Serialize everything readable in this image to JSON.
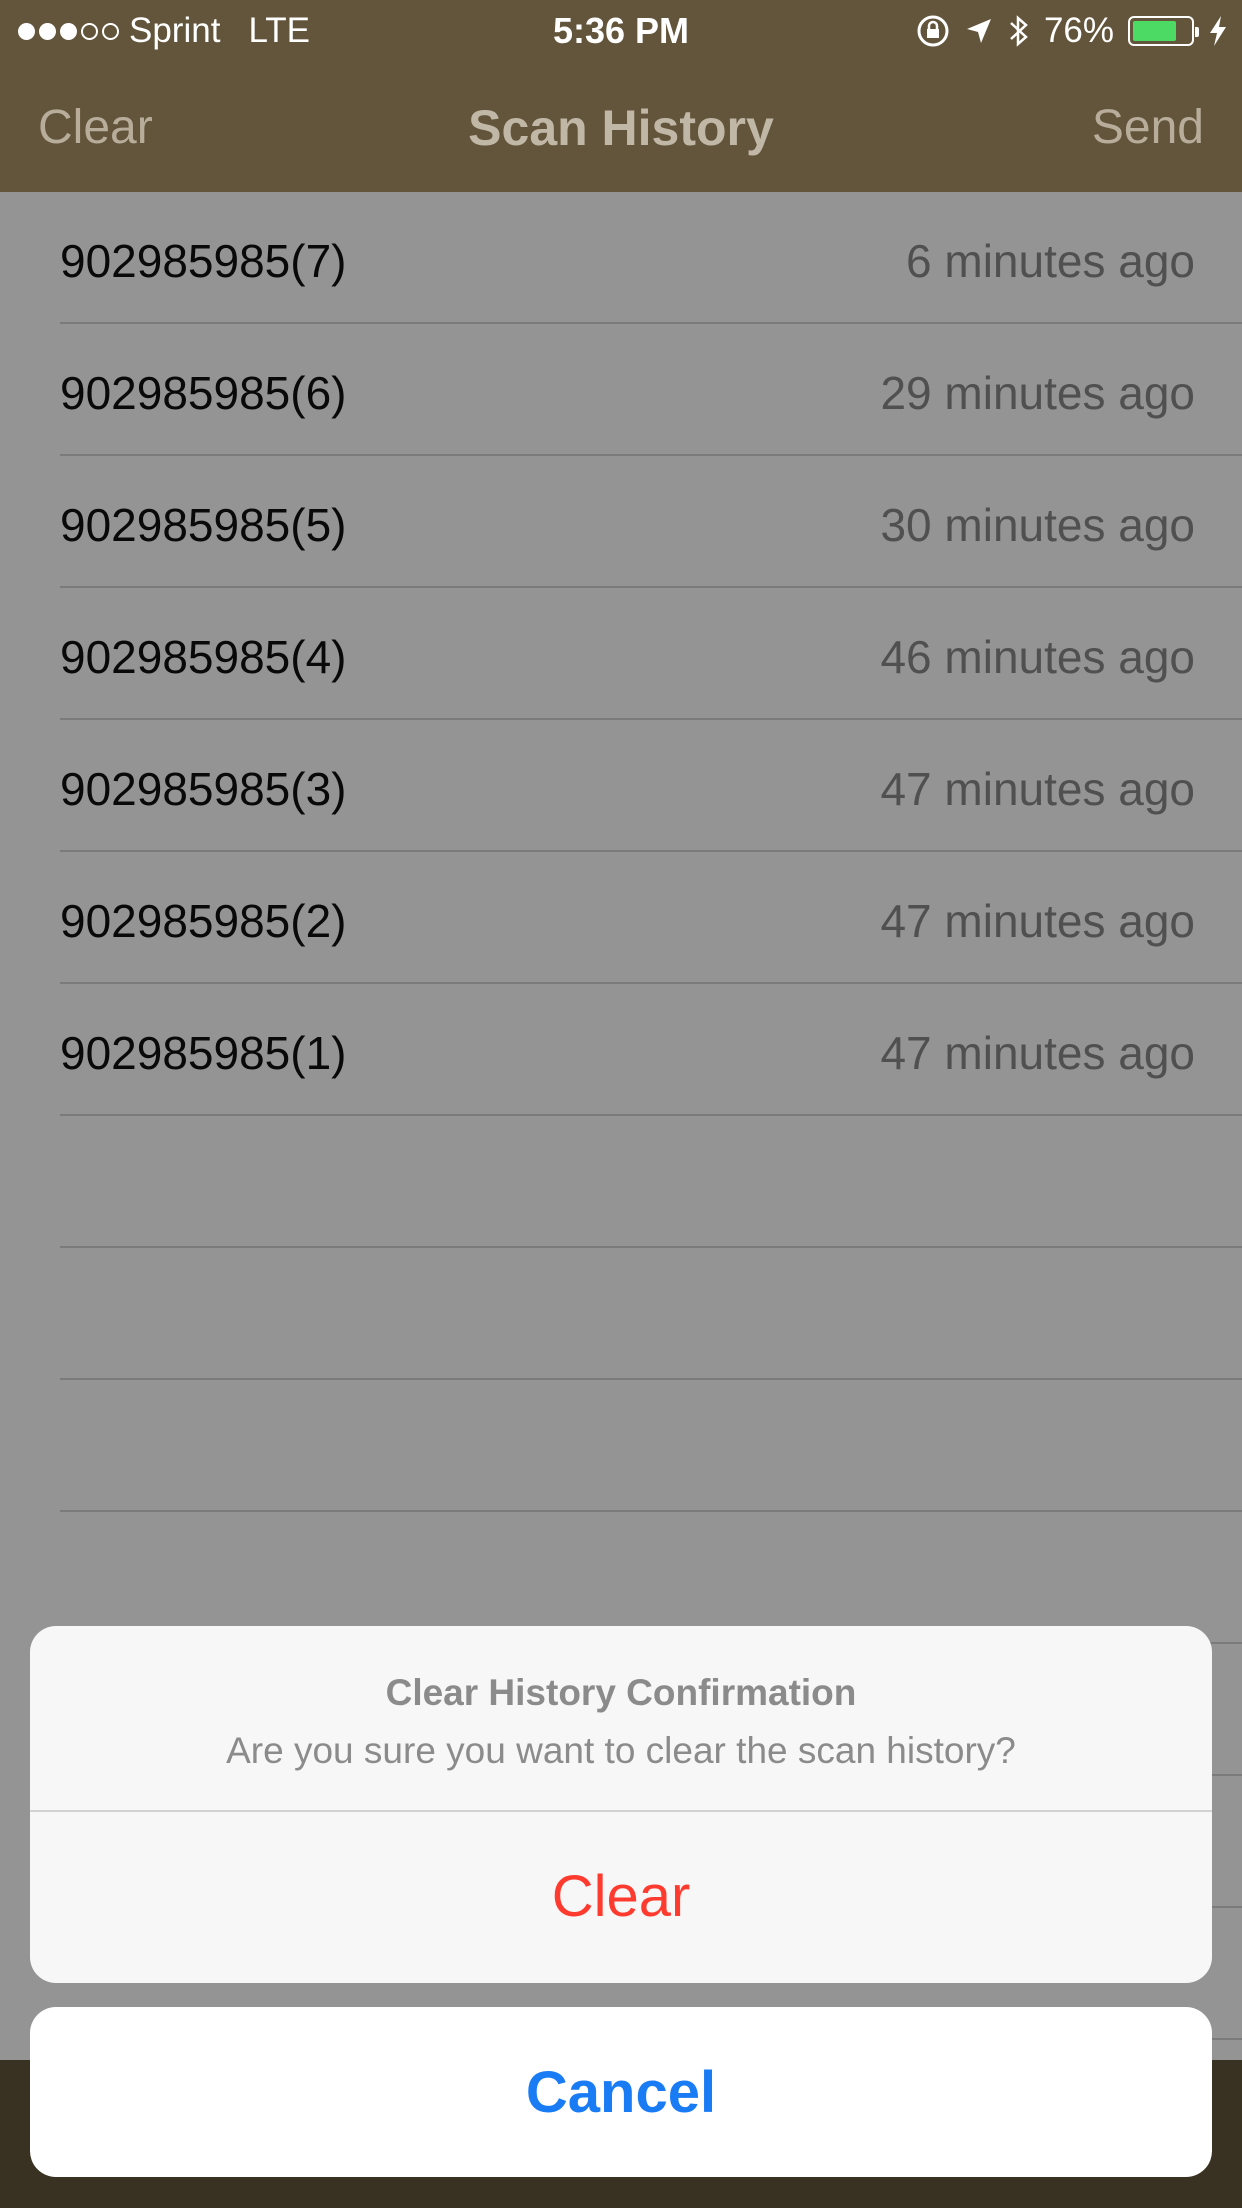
{
  "status_bar": {
    "carrier": "Sprint",
    "network": "LTE",
    "time": "5:36 PM",
    "battery_percent": "76%",
    "battery_level": 0.76,
    "signal_bars_filled": 3,
    "signal_bars_total": 5,
    "icons": [
      "orientation-lock-icon",
      "location-arrow-icon",
      "bluetooth-icon",
      "battery-icon",
      "charging-bolt-icon"
    ]
  },
  "nav": {
    "left_button": "Clear",
    "title": "Scan History",
    "right_button": "Send"
  },
  "history": {
    "rows": [
      {
        "code": "902985985(7)",
        "time": "6 minutes ago"
      },
      {
        "code": "902985985(6)",
        "time": "29 minutes ago"
      },
      {
        "code": "902985985(5)",
        "time": "30 minutes ago"
      },
      {
        "code": "902985985(4)",
        "time": "46 minutes ago"
      },
      {
        "code": "902985985(3)",
        "time": "47 minutes ago"
      },
      {
        "code": "902985985(2)",
        "time": "47 minutes ago"
      },
      {
        "code": "902985985(1)",
        "time": "47 minutes ago"
      }
    ]
  },
  "action_sheet": {
    "title": "Clear History Confirmation",
    "message": "Are you sure you want to clear the scan history?",
    "destructive_label": "Clear",
    "cancel_label": "Cancel"
  },
  "colors": {
    "bar": "#63553b",
    "destructive": "#ff3b30",
    "cancel": "#1a7cf5",
    "battery": "#4cd964"
  }
}
